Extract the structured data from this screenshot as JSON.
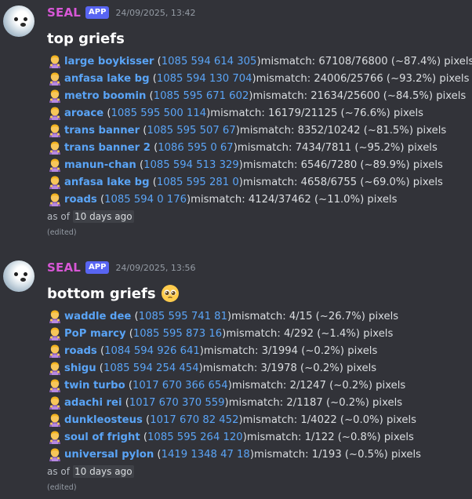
{
  "colors": {
    "background": "#323339",
    "username": "#d757d6",
    "app_tag": "#5865f2",
    "link": "#5aa4f6"
  },
  "messages": [
    {
      "author": "SEAL",
      "tag": "APP",
      "timestamp": "24/09/2025, 13:42",
      "title": "top griefs",
      "title_emoji": "",
      "rows": [
        {
          "icon": "person-bowing-emoji",
          "name": "large boykisser",
          "id": "1085 594 614 305",
          "text": " mismatch: 67108/76800 (~87.4%) pixels"
        },
        {
          "icon": "person-bowing-emoji",
          "name": "anfasa lake bg",
          "id": "1085 594 130 704",
          "text": " mismatch: 24006/25766 (~93.2%) pixels"
        },
        {
          "icon": "person-bowing-emoji",
          "name": "metro boomin",
          "id": "1085 595 671 602",
          "text": " mismatch: 21634/25600 (~84.5%) pixels"
        },
        {
          "icon": "person-bowing-emoji",
          "name": "aroace",
          "id": "1085 595 500 114",
          "text": " mismatch: 16179/21125 (~76.6%) pixels"
        },
        {
          "icon": "person-bowing-emoji",
          "name": "trans banner",
          "id": "1085 595 507 67",
          "text": " mismatch: 8352/10242 (~81.5%) pixels"
        },
        {
          "icon": "person-bowing-emoji",
          "name": "trans banner 2",
          "id": "1086 595 0 67",
          "text": " mismatch: 7434/7811 (~95.2%) pixels"
        },
        {
          "icon": "person-bowing-emoji",
          "name": "manun-chan",
          "id": "1085 594 513 329",
          "text": " mismatch: 6546/7280 (~89.9%) pixels"
        },
        {
          "icon": "person-bowing-emoji",
          "name": "anfasa lake bg",
          "id": "1085 595 281 0",
          "text": " mismatch: 4658/6755 (~69.0%) pixels"
        },
        {
          "icon": "person-bowing-emoji",
          "name": "roads",
          "id": "1085 594 0 176",
          "text": " mismatch: 4124/37462 (~11.0%) pixels"
        }
      ],
      "as_of": "as of",
      "relative_time": "10 days ago",
      "edited": "(edited)"
    },
    {
      "author": "SEAL",
      "tag": "APP",
      "timestamp": "24/09/2025, 13:56",
      "title": "bottom griefs",
      "title_emoji": "pleading-face-emoji",
      "rows": [
        {
          "icon": "person-bowing-emoji",
          "name": "waddle dee",
          "id": "1085 595 741 81",
          "text": " mismatch: 4/15 (~26.7%) pixels"
        },
        {
          "icon": "person-bowing-emoji",
          "name": "PoP marcy",
          "id": "1085 595 873 16",
          "text": " mismatch: 4/292 (~1.4%) pixels"
        },
        {
          "icon": "person-bowing-emoji",
          "name": "roads",
          "id": "1084 594 926 641",
          "text": " mismatch: 3/1994 (~0.2%) pixels"
        },
        {
          "icon": "person-bowing-emoji",
          "name": "shigu",
          "id": "1085 594 254 454",
          "text": " mismatch: 3/1978 (~0.2%) pixels"
        },
        {
          "icon": "person-bowing-emoji",
          "name": "twin turbo",
          "id": "1017 670 366 654",
          "text": " mismatch: 2/1247 (~0.2%) pixels"
        },
        {
          "icon": "person-bowing-emoji",
          "name": "adachi rei",
          "id": "1017 670 370 559",
          "text": " mismatch: 2/1187 (~0.2%) pixels"
        },
        {
          "icon": "person-bowing-emoji",
          "name": "dunkleosteus",
          "id": "1017 670 82 452",
          "text": " mismatch: 1/4022 (~0.0%) pixels"
        },
        {
          "icon": "person-bowing-emoji",
          "name": "soul of fright",
          "id": "1085 595 264 120",
          "text": " mismatch: 1/122 (~0.8%) pixels"
        },
        {
          "icon": "person-bowing-emoji",
          "name": "universal pylon",
          "id": "1419 1348 47 18",
          "text": " mismatch: 1/193 (~0.5%) pixels"
        }
      ],
      "as_of": "as of",
      "relative_time": "10 days ago",
      "edited": "(edited)"
    }
  ]
}
